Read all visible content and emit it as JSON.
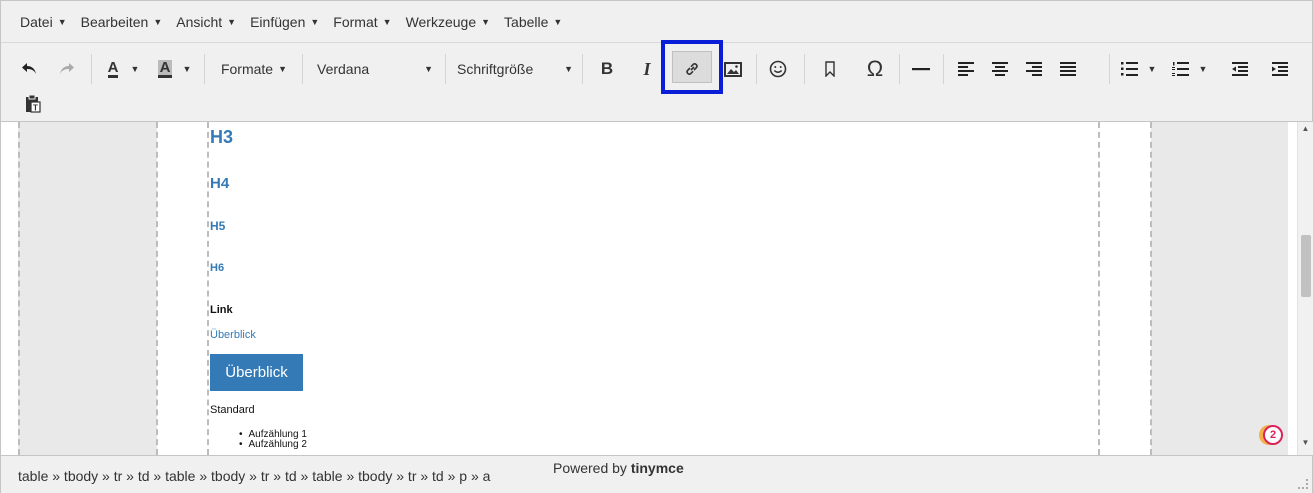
{
  "menubar": {
    "items": [
      "Datei",
      "Bearbeiten",
      "Ansicht",
      "Einfügen",
      "Format",
      "Werkzeuge",
      "Tabelle"
    ]
  },
  "toolbar": {
    "formats_label": "Formate",
    "font_family": "Verdana",
    "font_size_label": "Schriftgröße",
    "bold_label": "B",
    "italic_label": "I",
    "text_color_label": "A",
    "bg_color_label": "A",
    "special_char_label": "Ω"
  },
  "content": {
    "h3": "H3",
    "h4": "H4",
    "h5": "H5",
    "h6": "H6",
    "link_heading": "Link",
    "link_text": "Überblick",
    "button_text": "Überblick",
    "standard_label": "Standard",
    "bullets": [
      "Aufzählung 1",
      "Aufzählung 2"
    ]
  },
  "statusbar": {
    "path": "table » tbody » tr » td » table » tbody » tr » td » table » tbody » tr » td » p » a",
    "powered_prefix": "Powered by",
    "powered_brand": "tinymce"
  },
  "badge": {
    "count": "2"
  },
  "colors": {
    "accent": "#337ab7",
    "highlight_box": "#0a1ed8",
    "badge": "#d9245a"
  }
}
